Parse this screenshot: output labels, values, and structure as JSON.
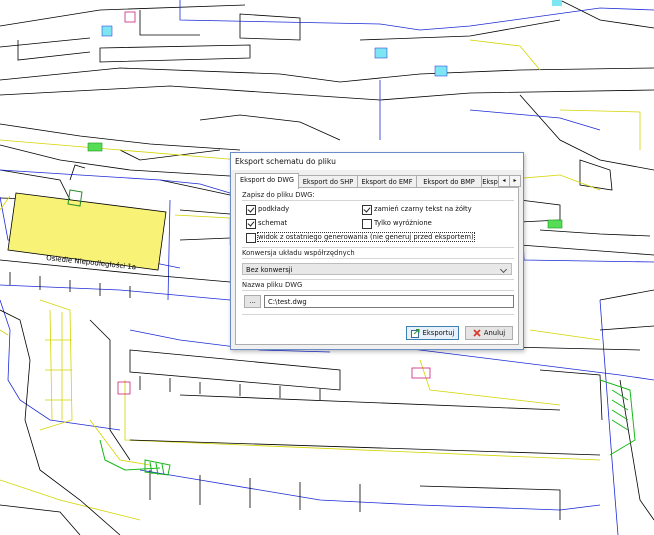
{
  "map": {
    "area_label": "Osiedle Niepodległości 1a"
  },
  "dialog": {
    "title": "Eksport schematu do pliku",
    "tabs": [
      {
        "label": "Eksport do DWG",
        "active": true
      },
      {
        "label": "Eksport do SHP",
        "active": false
      },
      {
        "label": "Eksport do EMF",
        "active": false
      },
      {
        "label": "Eksport do BMP",
        "active": false
      },
      {
        "label": "Eksp",
        "active": false
      }
    ],
    "tab_scroll_left_icon": "chevron-left-icon",
    "tab_scroll_right_icon": "chevron-right-icon",
    "save_group": {
      "label": "Zapisz do pliku DWG:",
      "checkboxes": {
        "podklady": {
          "label": "podkłady",
          "checked": true
        },
        "zamien": {
          "label": "zamień czarny tekst na żółty",
          "checked": true
        },
        "schemat": {
          "label": "schemat",
          "checked": true
        },
        "tylko": {
          "label": "Tylko wyróżnione",
          "checked": false
        },
        "widok": {
          "label": "widok z ostatniego generowania (nie generuj przed eksportem)",
          "checked": false
        }
      }
    },
    "conversion": {
      "label": "Konwersja układu współrzędnych",
      "selected": "Bez konwersji"
    },
    "filename": {
      "label": "Nazwa pliku DWG",
      "browse_label": "...",
      "value": "C:\\test.dwg"
    },
    "buttons": {
      "export": {
        "label": "Eksportuj",
        "icon": "export-icon"
      },
      "cancel": {
        "label": "Anuluj",
        "icon": "close-icon"
      }
    },
    "colors": {
      "accent": "#3c7fb1",
      "cancel_icon": "#d83b2b"
    }
  }
}
